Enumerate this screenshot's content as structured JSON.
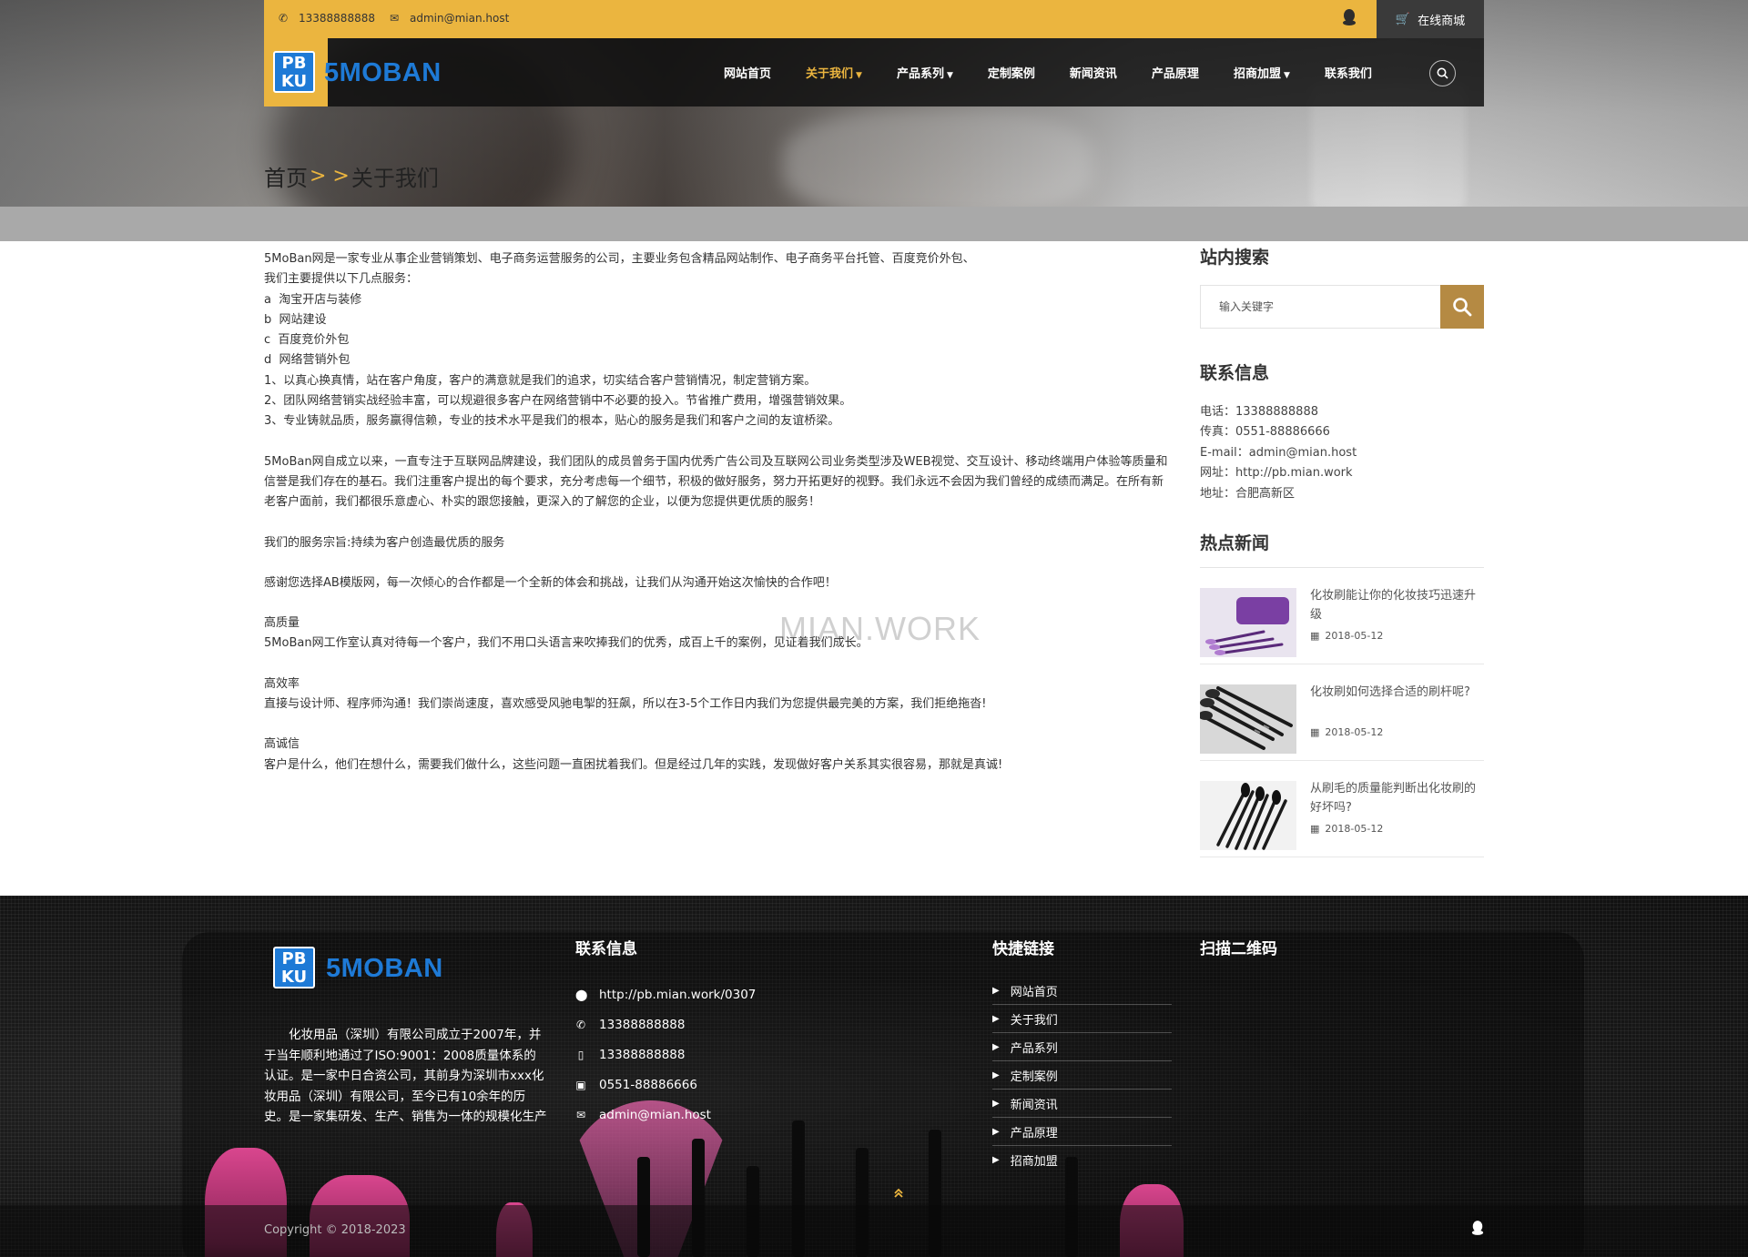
{
  "topbar": {
    "phone": "13388888888",
    "email": "admin@mian.host",
    "shop_label": "在线商城"
  },
  "brand": {
    "mark_line1": "PB",
    "mark_line2": "KU",
    "name": "5MOBAN",
    "accent_color": "#ebb53f",
    "brand_blue": "#1e7ad6"
  },
  "nav": {
    "items": [
      {
        "label": "网站首页",
        "dropdown": false
      },
      {
        "label": "关于我们",
        "dropdown": true,
        "active": true
      },
      {
        "label": "产品系列",
        "dropdown": true
      },
      {
        "label": "定制案例",
        "dropdown": false
      },
      {
        "label": "新闻资讯",
        "dropdown": false
      },
      {
        "label": "产品原理",
        "dropdown": false
      },
      {
        "label": "招商加盟",
        "dropdown": true
      },
      {
        "label": "联系我们",
        "dropdown": false
      }
    ]
  },
  "breadcrumb": {
    "home": "首页",
    "sep": "> >",
    "current": "关于我们"
  },
  "content": {
    "paragraphs": [
      "5MoBan网是一家专业从事企业营销策划、电子商务运营服务的公司，主要业务包含精品网站制作、电子商务平台托管、百度竞价外包、\n我们主要提供以下几点服务：\na  淘宝开店与装修\nb  网站建设\nc  百度竞价外包\nd  网络营销外包\n1、以真心换真情，站在客户角度，客户的满意就是我们的追求，切实结合客户营销情况，制定营销方案。\n2、团队网络营销实战经验丰富，可以规避很多客户在网络营销中不必要的投入。节省推广费用，增强营销效果。\n3、专业铸就品质，服务赢得信赖，专业的技术水平是我们的根本，贴心的服务是我们和客户之间的友谊桥梁。",
      "5MoBan网自成立以来，一直专注于互联网品牌建设，我们团队的成员曾务于国内优秀广告公司及互联网公司业务类型涉及WEB视觉、交互设计、移动终端用户体验等质量和信誉是我们存在的基石。我们注重客户提出的每个要求，充分考虑每一个细节，积极的做好服务，努力开拓更好的视野。我们永远不会因为我们曾经的成绩而满足。在所有新老客户面前，我们都很乐意虚心、朴实的跟您接触，更深入的了解您的企业，以便为您提供更优质的服务！",
      "我们的服务宗旨:持续为客户创造最优质的服务",
      "感谢您选择AB模版网，每一次倾心的合作都是一个全新的体会和挑战，让我们从沟通开始这次愉快的合作吧！",
      "高质量\n5MoBan网工作室认真对待每一个客户，我们不用口头语言来吹捧我们的优秀，成百上千的案例，见证着我们成长。",
      "高效率\n直接与设计师、程序师沟通！我们崇尚速度，喜欢感受风驰电掣的狂飙，所以在3-5个工作日内我们为您提供最完美的方案，我们拒绝拖沓!",
      "高诚信\n客户是什么，他们在想什么，需要我们做什么，这些问题一直困扰着我们。但是经过几年的实践，发现做好客户关系其实很容易，那就是真诚!"
    ],
    "watermark": "MIAN.WORK"
  },
  "sidebar": {
    "search_title": "站内搜索",
    "search_placeholder": "输入关键字",
    "contact_title": "联系信息",
    "contact_lines": [
      "电话：13388888888",
      "传真：0551-88886666",
      "E-mail：admin@mian.host",
      "网址：http://pb.mian.work",
      "地址：合肥高新区"
    ],
    "news_title": "热点新闻",
    "news": [
      {
        "title": "化妆刷能让你的化妆技巧迅速升级",
        "date": "2018-05-12"
      },
      {
        "title": "化妆刷如何选择合适的刷杆呢?",
        "date": "2018-05-12"
      },
      {
        "title": "从刷毛的质量能判断出化妆刷的好坏吗?",
        "date": "2018-05-12"
      }
    ]
  },
  "footer": {
    "description": "化妆用品（深圳）有限公司成立于2007年，并于当年顺利地通过了ISO:9001：2008质量体系的认证。是一家中日合资公司，其前身为深圳市xxx化妆用品（深圳）有限公司，至今已有10余年的历史。是一家集研发、生产、销售为一体的规模化生产化妆用具的专业厂家。 目前有自动…",
    "contact_title": "联系信息",
    "contacts": [
      {
        "icon": "map-marker-icon",
        "text": "http://pb.mian.work/0307"
      },
      {
        "icon": "phone-icon",
        "text": "13388888888"
      },
      {
        "icon": "mobile-icon",
        "text": "13388888888"
      },
      {
        "icon": "fax-icon",
        "text": "0551-88886666"
      },
      {
        "icon": "envelope-icon",
        "text": "admin@mian.host"
      }
    ],
    "links_title": "快捷链接",
    "links": [
      "网站首页",
      "关于我们",
      "产品系列",
      "定制案例",
      "新闻资讯",
      "产品原理",
      "招商加盟"
    ],
    "qr_title": "扫描二维码",
    "copyright": "Copyright © 2018-2023"
  }
}
